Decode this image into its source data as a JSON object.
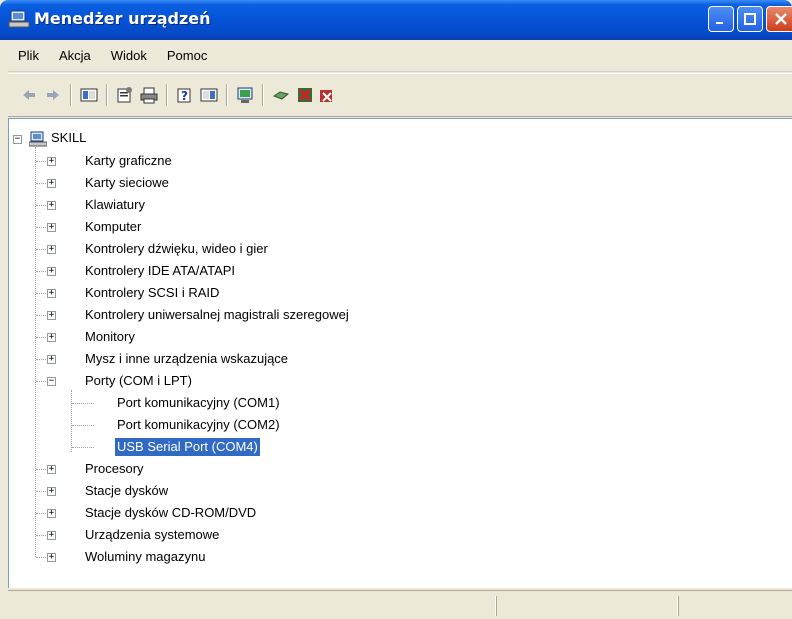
{
  "window": {
    "title": "Menedżer urządzeń"
  },
  "menu": [
    "Plik",
    "Akcja",
    "Widok",
    "Pomoc"
  ],
  "tree": {
    "root": "SKILL",
    "categories": [
      {
        "label": "Karty graficzne",
        "icon": "display-adapter-icon"
      },
      {
        "label": "Karty sieciowe",
        "icon": "network-card-icon"
      },
      {
        "label": "Klawiatury",
        "icon": "keyboard-icon"
      },
      {
        "label": "Komputer",
        "icon": "computer-icon"
      },
      {
        "label": "Kontrolery dźwięku, wideo i gier",
        "icon": "sound-icon"
      },
      {
        "label": "Kontrolery IDE ATA/ATAPI",
        "icon": "ide-controller-icon"
      },
      {
        "label": "Kontrolery SCSI i RAID",
        "icon": "scsi-icon"
      },
      {
        "label": "Kontrolery uniwersalnej magistrali szeregowej",
        "icon": "usb-icon"
      },
      {
        "label": "Monitory",
        "icon": "monitor-icon"
      },
      {
        "label": "Mysz i inne urządzenia wskazujące",
        "icon": "mouse-icon"
      },
      {
        "label": "Porty (COM i LPT)",
        "icon": "port-icon",
        "expanded": true,
        "children": [
          {
            "label": "Port komunikacyjny (COM1)",
            "icon": "port-icon"
          },
          {
            "label": "Port komunikacyjny (COM2)",
            "icon": "port-icon"
          },
          {
            "label": "USB Serial Port (COM4)",
            "icon": "port-icon",
            "selected": true
          }
        ]
      },
      {
        "label": "Procesory",
        "icon": "processor-icon"
      },
      {
        "label": "Stacje dysków",
        "icon": "disk-drive-icon"
      },
      {
        "label": "Stacje dysków CD-ROM/DVD",
        "icon": "cdrom-icon"
      },
      {
        "label": "Urządzenia systemowe",
        "icon": "system-devices-icon"
      },
      {
        "label": "Woluminy magazynu",
        "icon": "storage-volume-icon"
      }
    ]
  },
  "colors": {
    "selection": "#316ac5",
    "titlebar": "#0553d6"
  }
}
